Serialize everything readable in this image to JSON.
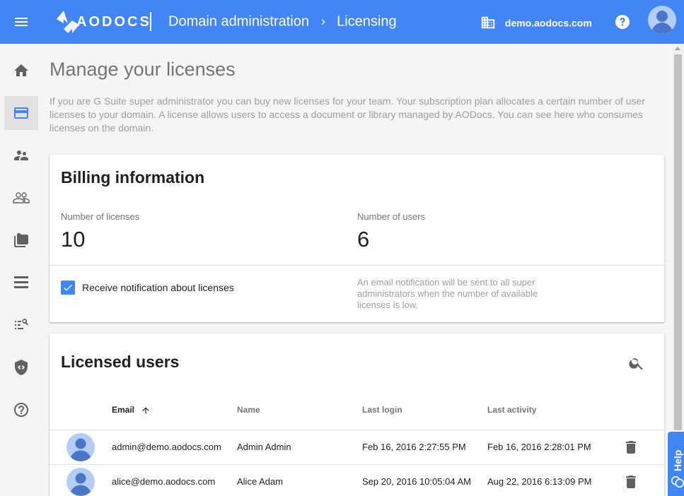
{
  "topbar": {
    "logo_text": "AODOCS",
    "breadcrumb": {
      "parent": "Domain administration",
      "current": "Licensing"
    },
    "domain": "demo.aodocs.com"
  },
  "page": {
    "title": "Manage your licenses",
    "description": "If you are G Suite super administrator you can buy new licenses for your team. Your subscription plan allocates a certain number of user licenses to your domain. A license allows users to access a document or library managed by AODocs. You can see here who consumes licenses on the domain."
  },
  "billing": {
    "title": "Billing information",
    "licenses_label": "Number of licenses",
    "licenses_value": "10",
    "users_label": "Number of users",
    "users_value": "6",
    "notification_label": "Receive notification about licenses",
    "notification_checked": true,
    "notification_help": "An email notification will be sent to all super administrators when the number of available licenses is low."
  },
  "licensed_users": {
    "title": "Licensed users",
    "columns": {
      "email": "Email",
      "name": "Name",
      "last_login": "Last login",
      "last_activity": "Last activity"
    },
    "sort": {
      "column": "email",
      "direction": "ascending"
    },
    "rows": [
      {
        "email": "admin@demo.aodocs.com",
        "name": "Admin Admin",
        "last_login": "Feb 16, 2016 2:27:55 PM",
        "last_activity": "Feb 16, 2016 2:28:01 PM"
      },
      {
        "email": "alice@demo.aodocs.com",
        "name": "Alice Adam",
        "last_login": "Sep 20, 2016 10:05:04 AM",
        "last_activity": "Aug 22, 2016 6:13:09 PM"
      }
    ]
  },
  "help_tab": {
    "label": "Help"
  },
  "colors": {
    "primary": "#4285f4",
    "avatar": "#4a76c9",
    "avatar_bg": "#b3cdf6"
  },
  "nav_icons": [
    "home-icon",
    "credit-card-icon",
    "supervisor-icon",
    "people-icon",
    "folders-icon",
    "list-icon",
    "search-list-icon",
    "shield-code-icon",
    "help-circle-icon"
  ]
}
